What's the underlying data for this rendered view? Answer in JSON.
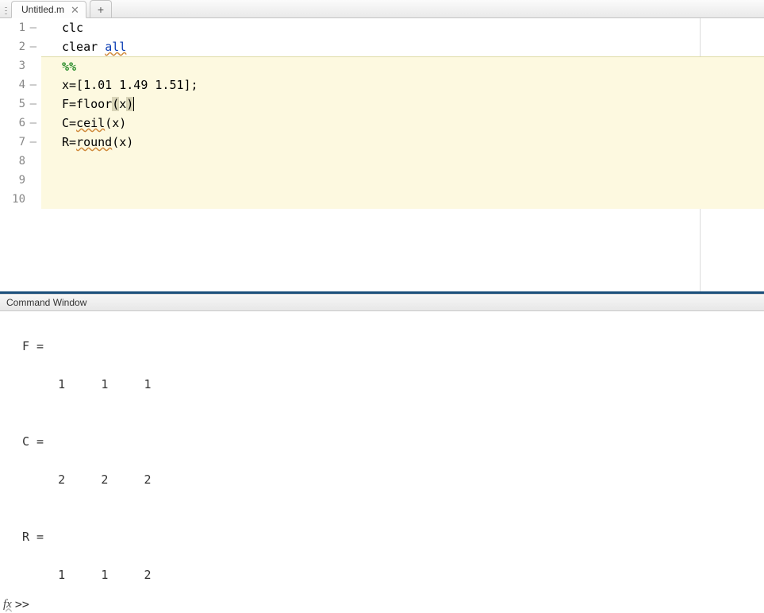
{
  "tab": {
    "title": "Untitled.m",
    "close_glyph": "✕",
    "add_glyph": "+"
  },
  "editor": {
    "lines": [
      {
        "num": "1",
        "dash": "–"
      },
      {
        "num": "2",
        "dash": "–"
      },
      {
        "num": "3",
        "dash": ""
      },
      {
        "num": "4",
        "dash": "–"
      },
      {
        "num": "5",
        "dash": "–"
      },
      {
        "num": "6",
        "dash": "–"
      },
      {
        "num": "7",
        "dash": "–"
      },
      {
        "num": "8",
        "dash": ""
      },
      {
        "num": "9",
        "dash": ""
      },
      {
        "num": "10",
        "dash": ""
      }
    ],
    "code": {
      "l1": "clc",
      "l2a": "clear ",
      "l2b": "all",
      "l3": "%%",
      "l4": "x=[1.01 1.49 1.51];",
      "l5a": "F=floor",
      "l5b": "(",
      "l5c": "x",
      "l5d": ")",
      "l6a": "C=",
      "l6b": "ceil",
      "l6c": "(x)",
      "l7a": "R=",
      "l7b": "round",
      "l7c": "(x)"
    }
  },
  "command_window": {
    "title": "Command Window",
    "output": "\nF =\n\n     1     1     1\n\n\nC =\n\n     2     2     2\n\n\nR =\n\n     1     1     2\n",
    "fx": "fx",
    "prompt": ">>"
  }
}
